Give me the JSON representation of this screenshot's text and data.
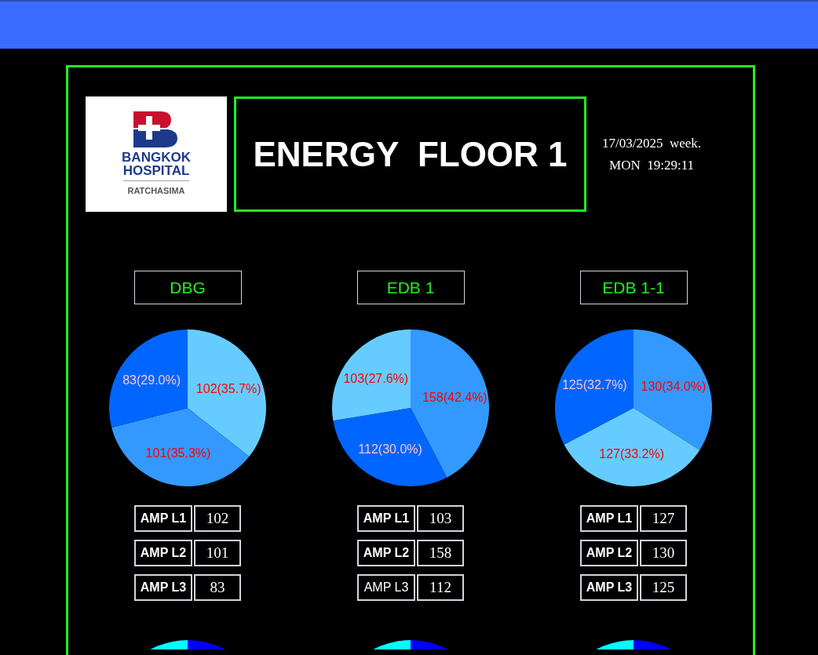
{
  "logo": {
    "line_1": "BANGKOK",
    "line_2": "HOSPITAL",
    "line_3": "RATCHASIMA"
  },
  "title": "ENERGY  FLOOR 1",
  "date": "17/03/2025  week.",
  "time": "MON  19:29:11",
  "panels": [
    {
      "name": "DBG",
      "chart_data": {
        "type": "pie",
        "values": [
          102,
          101,
          83
        ],
        "colors": [
          "#66ccff",
          "#3399ff",
          "#0066ff"
        ],
        "value_labels": [
          "102(35.7%)",
          "101(35.3%)",
          "83(29.0%)"
        ]
      },
      "rows": [
        {
          "label": "AMP L1",
          "value": "102",
          "bold": true
        },
        {
          "label": "AMP L2",
          "value": "101",
          "bold": true
        },
        {
          "label": "AMP L3",
          "value": "83",
          "bold": true
        }
      ]
    },
    {
      "name": "EDB 1",
      "chart_data": {
        "type": "pie",
        "values": [
          158,
          112,
          103
        ],
        "colors": [
          "#3399ff",
          "#0066ff",
          "#66ccff"
        ],
        "value_labels": [
          "158(42.4%)",
          "112(30.0%)",
          "103(27.6%)"
        ]
      },
      "rows": [
        {
          "label": "AMP L1",
          "value": "103",
          "bold": true
        },
        {
          "label": "AMP L2",
          "value": "158",
          "bold": true
        },
        {
          "label": "AMP L3",
          "value": "112",
          "bold": false
        }
      ]
    },
    {
      "name": "EDB 1-1",
      "chart_data": {
        "type": "pie",
        "values": [
          130,
          127,
          125
        ],
        "colors": [
          "#3399ff",
          "#66ccff",
          "#0066ff"
        ],
        "value_labels": [
          "130(34.0%)",
          "127(33.2%)",
          "125(32.7%)"
        ]
      },
      "rows": [
        {
          "label": "AMP L1",
          "value": "127",
          "bold": true
        },
        {
          "label": "AMP L2",
          "value": "130",
          "bold": true
        },
        {
          "label": "AMP L3",
          "value": "125",
          "bold": true
        }
      ]
    }
  ]
}
